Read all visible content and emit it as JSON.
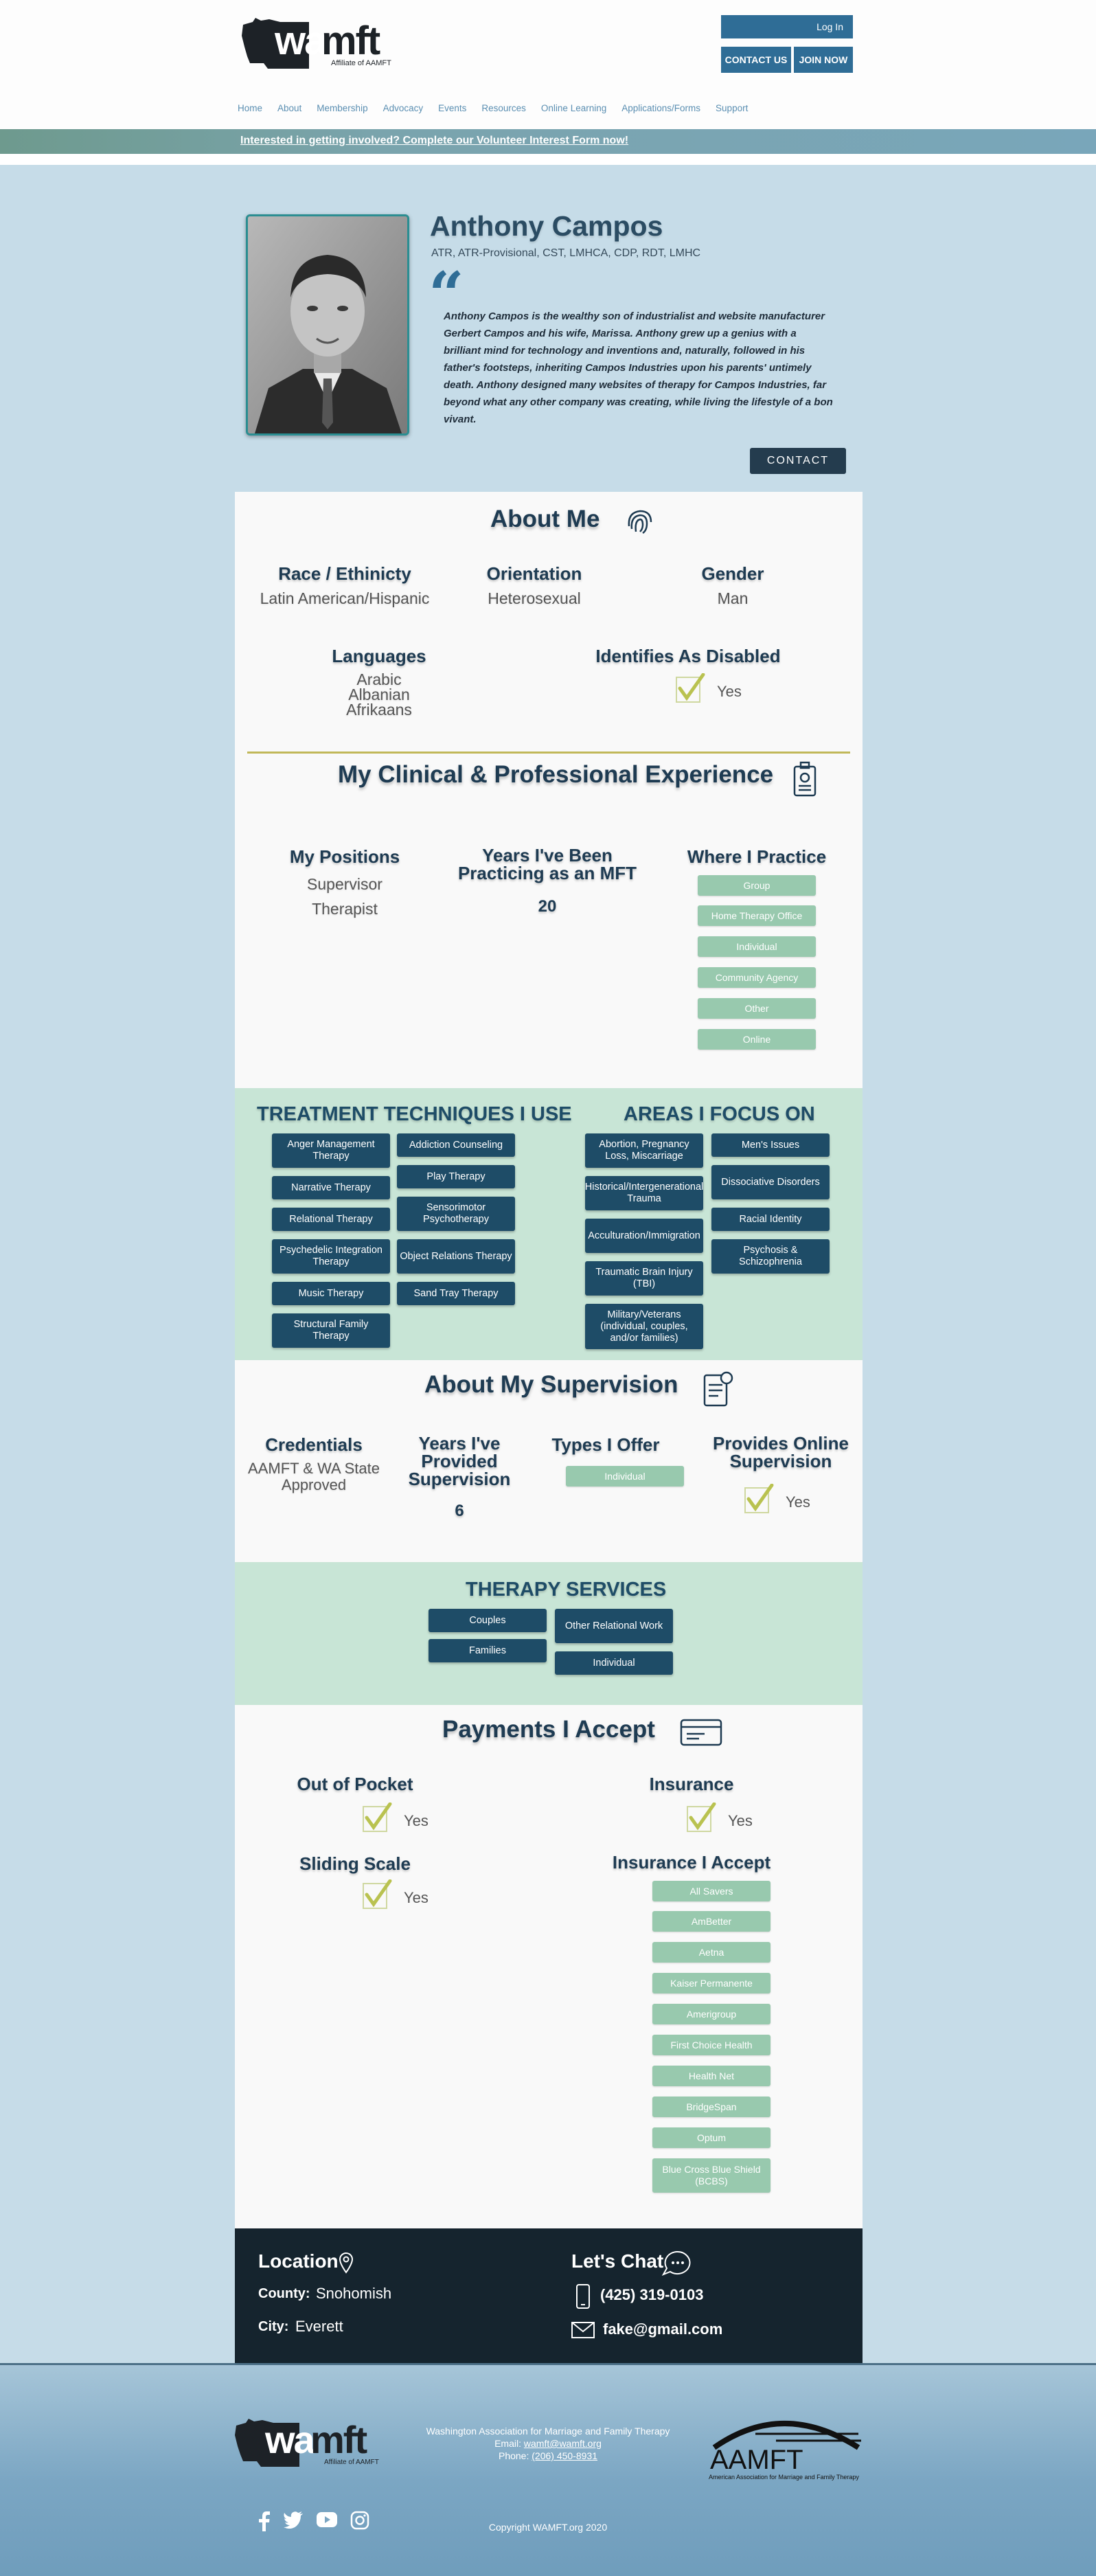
{
  "header": {
    "logo_text": "wamft",
    "logo_tagline": "Affiliate of AAMFT",
    "login_label": "Log In",
    "contact_us_label": "CONTACT US",
    "join_now_label": "JOIN NOW",
    "nav": [
      "Home",
      "About",
      "Membership",
      "Advocacy",
      "Events",
      "Resources",
      "Online Learning",
      "Applications/Forms",
      "Support"
    ]
  },
  "banner": {
    "text": "Interested in getting involved? Complete our Volunteer Interest Form now!"
  },
  "profile": {
    "name": "Anthony Campos",
    "credentials": "ATR, ATR-Provisional, CST, LMHCA, CDP, RDT, LMHC",
    "bio": "Anthony Campos is the wealthy son of industrialist and website manufacturer Gerbert Campos and his wife, Marissa. Anthony grew up a genius with a brilliant mind for technology and inventions and, naturally, followed in his father's footsteps, inheriting Campos Industries upon his parents' untimely death. Anthony designed many websites of therapy for Campos Industries, far beyond what any other company was creating, while living the lifestyle of a bon vivant.",
    "contact_label": "CONTACT"
  },
  "about_me": {
    "title": "About Me",
    "race_label": "Race / Ethinicty",
    "race_value": "Latin American/Hispanic",
    "orientation_label": "Orientation",
    "orientation_value": "Heterosexual",
    "gender_label": "Gender",
    "gender_value": "Man",
    "languages_label": "Languages",
    "languages": [
      "Arabic",
      "Albanian",
      "Afrikaans"
    ],
    "disabled_label": "Identifies As Disabled",
    "disabled_value": "Yes"
  },
  "experience": {
    "title": "My Clinical & Professional Experience",
    "positions_label": "My Positions",
    "positions": [
      "Supervisor",
      "Therapist"
    ],
    "years_label_1": "Years I've Been",
    "years_label_2": "Practicing as an MFT",
    "years_value": "20",
    "practice_label": "Where I Practice",
    "practice": [
      "Group",
      "Home Therapy Office",
      "Individual",
      "Community Agency",
      "Other",
      "Online"
    ]
  },
  "techniques": {
    "title": "TREATMENT TECHNIQUES I USE",
    "col1": [
      "Anger Management Therapy",
      "Narrative Therapy",
      "Relational Therapy",
      "Psychedelic Integration Therapy",
      "Music Therapy",
      "Structural Family Therapy"
    ],
    "col2": [
      "Addiction Counseling",
      "Play Therapy",
      "Sensorimotor Psychotherapy",
      "Object Relations Therapy",
      "Sand Tray Therapy"
    ]
  },
  "focus": {
    "title": "AREAS I FOCUS ON",
    "col1": [
      "Abortion, Pregnancy Loss, Miscarriage",
      "Historical/Intergenerational Trauma",
      "Acculturation/Immigration",
      "Traumatic Brain Injury (TBI)",
      "Military/Veterans (individual, couples, and/or families)"
    ],
    "col2": [
      "Men's Issues",
      "Dissociative Disorders",
      "Racial Identity",
      "Psychosis & Schizophrenia"
    ]
  },
  "supervision": {
    "title": "About My Supervision",
    "credentials_label": "Credentials",
    "credentials_value_1": "AAMFT & WA State",
    "credentials_value_2": "Approved",
    "years_label_1": "Years I've",
    "years_label_2": "Provided",
    "years_label_3": "Supervision",
    "years_value": "6",
    "types_label": "Types I Offer",
    "types": [
      "Individual"
    ],
    "online_label_1": "Provides Online",
    "online_label_2": "Supervision",
    "online_value": "Yes"
  },
  "services": {
    "title": "THERAPY SERVICES",
    "col1": [
      "Couples",
      "Families"
    ],
    "col2": [
      "Other Relational Work",
      "Individual"
    ]
  },
  "payments": {
    "title": "Payments I Accept",
    "out_of_pocket_label": "Out of Pocket",
    "out_of_pocket_value": "Yes",
    "insurance_label": "Insurance",
    "insurance_value": "Yes",
    "sliding_label": "Sliding Scale",
    "sliding_value": "Yes",
    "accept_label": "Insurance I Accept",
    "insurers": [
      "All Savers",
      "AmBetter",
      "Aetna",
      "Kaiser Permanente",
      "Amerigroup",
      "First Choice Health",
      "Health Net",
      "BridgeSpan",
      "Optum",
      "Blue Cross Blue Shield (BCBS)"
    ]
  },
  "contact": {
    "location_label": "Location",
    "county_key": "County:",
    "county_value": "Snohomish",
    "city_key": "City:",
    "city_value": "Everett",
    "chat_label": "Let's Chat",
    "phone": "(425) 319-0103",
    "email": "fake@gmail.com"
  },
  "footer": {
    "org_name": "Washington Association for Marriage and Family Therapy",
    "email_key": "Email:",
    "email_value": "wamft@wamft.org",
    "phone_key": "Phone:",
    "phone_value": "(206) 450-8931",
    "copyright": "Copyright WAMFT.org  2020",
    "aamft_text": "AAMFT",
    "aamft_tagline": "American Association for Marriage and Family Therapy",
    "wamft_text": "wamft",
    "wamft_tagline": "Affiliate of AAMFT"
  },
  "colors": {
    "page_bg": "#c6dce8",
    "header_button": "#2f6d96",
    "dark_pill": "#1e4c67",
    "green_pill": "#98c9ae",
    "green_section": "#c8e5d6",
    "contact_block": "#15242e"
  }
}
